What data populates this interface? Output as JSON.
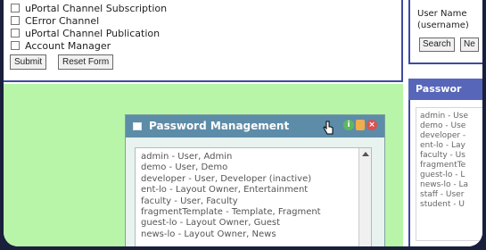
{
  "form": {
    "options": [
      "uPortal Channel Subscription",
      "CError Channel",
      "uPortal Channel Publication",
      "Account Manager"
    ],
    "submit_label": "Submit",
    "reset_label": "Reset Form"
  },
  "right_panel": {
    "user_name_label": "User Name",
    "username_hint": "(username)",
    "search_label": "Search",
    "next_label": "Ne",
    "password_title": "Passwor",
    "users": [
      "admin - Use",
      "demo - Use",
      "developer -",
      "ent-lo - Lay",
      "faculty - Us",
      "fragmentTe",
      "guest-lo - L",
      "news-lo - La",
      "staff - User",
      "student - U"
    ]
  },
  "portlet": {
    "title": "Password Management",
    "users": [
      "admin - User, Admin",
      "demo - User, Demo",
      "developer - User, Developer (inactive)",
      "ent-lo - Layout Owner, Entertainment",
      "faculty - User, Faculty",
      "fragmentTemplate - Template, Fragment",
      "guest-lo - Layout Owner, Guest",
      "news-lo - Layout Owner, News"
    ],
    "controls": {
      "info_icon": "info-icon",
      "edit_icon": "edit-icon",
      "close_icon": "close-icon"
    }
  },
  "colors": {
    "green_area": "#b9f5a8",
    "portlet_header": "#5d8ca8",
    "panel_border": "#3e4aa0",
    "right_header": "#5766b8"
  }
}
